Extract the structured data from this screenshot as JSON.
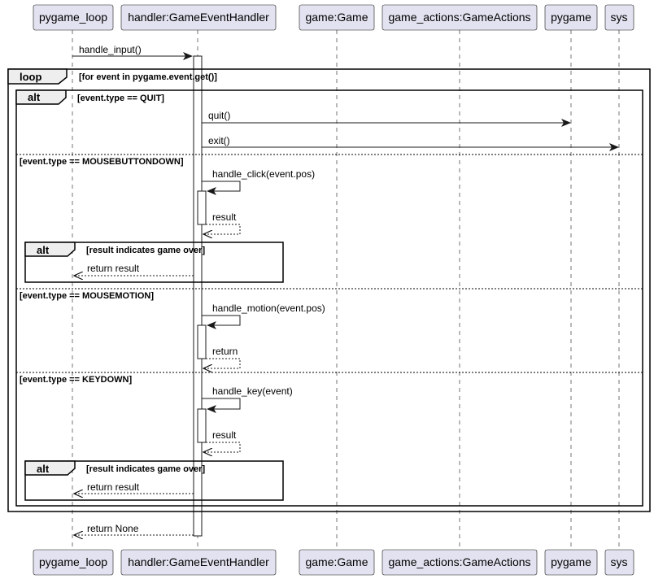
{
  "participants": [
    {
      "id": "pygame_loop",
      "label": "pygame_loop"
    },
    {
      "id": "handler",
      "label": "handler:GameEventHandler"
    },
    {
      "id": "game",
      "label": "game:Game"
    },
    {
      "id": "game_actions",
      "label": "game_actions:GameActions"
    },
    {
      "id": "pygame",
      "label": "pygame"
    },
    {
      "id": "sys",
      "label": "sys"
    }
  ],
  "frames": {
    "loop": {
      "keyword": "loop",
      "guard": "[for event in pygame.event.get()]"
    },
    "alt_main": {
      "keyword": "alt",
      "guard_quit": "[event.type == QUIT]",
      "guard_mousebuttondown": "[event.type == MOUSEBUTTONDOWN]",
      "guard_mousemotion": "[event.type == MOUSEMOTION]",
      "guard_keydown": "[event.type == KEYDOWN]"
    },
    "alt_click_result": {
      "keyword": "alt",
      "guard": "[result indicates game over]"
    },
    "alt_key_result": {
      "keyword": "alt",
      "guard": "[result indicates game over]"
    }
  },
  "messages": {
    "handle_input": "handle_input()",
    "quit": "quit()",
    "exit": "exit()",
    "handle_click": "handle_click(event.pos)",
    "click_result": "result",
    "click_return": "return result",
    "handle_motion": "handle_motion(event.pos)",
    "motion_return": "return",
    "handle_key": "handle_key(event)",
    "key_result": "result",
    "key_return": "return result",
    "return_none": "return None"
  }
}
